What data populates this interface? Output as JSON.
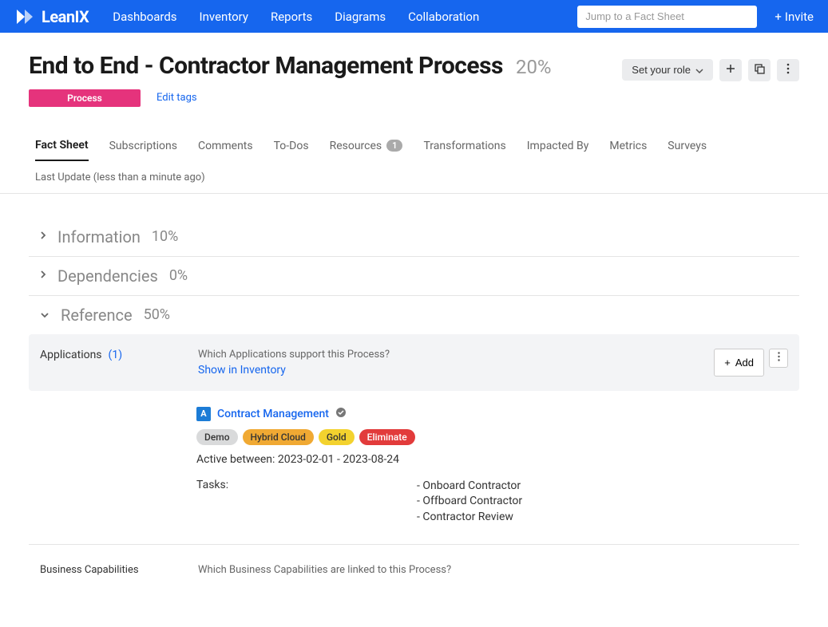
{
  "header": {
    "brand": "LeanIX",
    "nav": [
      "Dashboards",
      "Inventory",
      "Reports",
      "Diagrams",
      "Collaboration"
    ],
    "search_placeholder": "Jump to a Fact Sheet",
    "invite": "Invite"
  },
  "page": {
    "title": "End to End - Contractor Management Process",
    "percent": "20%",
    "role_button": "Set your role",
    "badge": "Process",
    "edit_tags": "Edit tags"
  },
  "tabs": [
    {
      "label": "Fact Sheet"
    },
    {
      "label": "Subscriptions"
    },
    {
      "label": "Comments"
    },
    {
      "label": "To-Dos"
    },
    {
      "label": "Resources",
      "badge": "1"
    },
    {
      "label": "Transformations"
    },
    {
      "label": "Impacted By"
    },
    {
      "label": "Metrics"
    },
    {
      "label": "Surveys"
    }
  ],
  "last_update": "Last Update (less than a minute ago)",
  "sections": {
    "information": {
      "title": "Information",
      "percent": "10%"
    },
    "dependencies": {
      "title": "Dependencies",
      "percent": "0%"
    },
    "reference": {
      "title": "Reference",
      "percent": "50%"
    }
  },
  "applications": {
    "label": "Applications",
    "count": "(1)",
    "question": "Which Applications support this Process?",
    "show_link": "Show in Inventory",
    "add_label": "Add",
    "item": {
      "badge": "A",
      "name": "Contract Management",
      "tags": [
        {
          "text": "Demo",
          "cls": "gray"
        },
        {
          "text": "Hybrid Cloud",
          "cls": "orange"
        },
        {
          "text": "Gold",
          "cls": "yellow"
        },
        {
          "text": "Eliminate",
          "cls": "red"
        }
      ],
      "active": "Active between: 2023-02-01 - 2023-08-24",
      "tasks_label": "Tasks:",
      "tasks": [
        "- Onboard Contractor",
        "- Offboard Contractor",
        "- Contractor Review"
      ]
    }
  },
  "business_capabilities": {
    "label": "Business Capabilities",
    "question": "Which Business Capabilities are linked to this Process?"
  }
}
